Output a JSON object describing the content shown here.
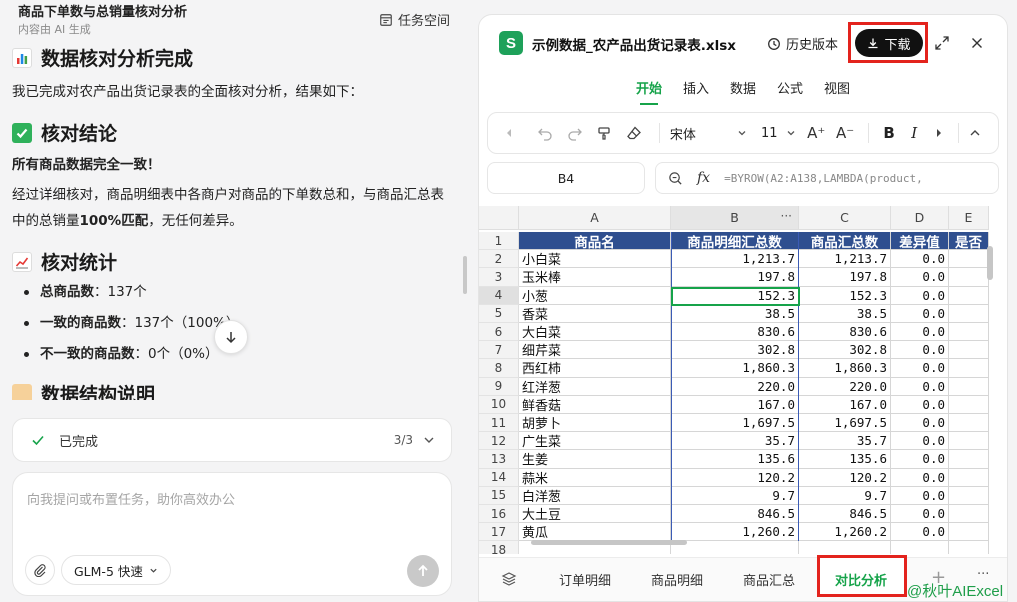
{
  "chat": {
    "title": "商品下单数与总销量核对分析",
    "subtitle": "内容由 AI 生成",
    "task_space": "任务空间",
    "heading1": "数据核对分析完成",
    "intro": "我已完成对农产品出货记录表的全面核对分析，结果如下：",
    "heading2": "核对结论",
    "conclusion_bold": "所有商品数据完全一致！",
    "para_a": "经过详细核对，商品明细表中各商户对商品的下单数总和，与商品汇总表中的总销量",
    "para_bold": "100%匹配",
    "para_b": "，无任何差异。",
    "heading3": "核对统计",
    "stats": [
      {
        "label": "总商品数",
        "value": "：137个"
      },
      {
        "label": "一致的商品数",
        "value": "：137个（100%）"
      },
      {
        "label": "不一致的商品数",
        "value": "：0个（0%）"
      }
    ],
    "heading4_partial": "数据结构说明",
    "status_label": "已完成",
    "status_count": "3/3",
    "input_placeholder": "向我提问或布置任务，助你高效办公",
    "model_label": "GLM-5 快速"
  },
  "sheet": {
    "file_icon": "S",
    "file_name": "示例数据_农产品出货记录表.xlsx",
    "history": "历史版本",
    "download": "下载",
    "menu": [
      "开始",
      "插入",
      "数据",
      "公式",
      "视图"
    ],
    "active_menu": 0,
    "font_name": "宋体",
    "font_size": "11",
    "cell_ref": "B4",
    "formula": "=BYROW(A2:A138,LAMBDA(product,",
    "columns": [
      "A",
      "B",
      "C",
      "D",
      "E"
    ],
    "header_row": [
      "商品名",
      "商品明细汇总数",
      "商品汇总数",
      "差异值",
      "是否"
    ],
    "rows": [
      [
        "小白菜",
        "1,213.7",
        "1,213.7",
        "0.0"
      ],
      [
        "玉米棒",
        "197.8",
        "197.8",
        "0.0"
      ],
      [
        "小葱",
        "152.3",
        "152.3",
        "0.0"
      ],
      [
        "香菜",
        "38.5",
        "38.5",
        "0.0"
      ],
      [
        "大白菜",
        "830.6",
        "830.6",
        "0.0"
      ],
      [
        "细芹菜",
        "302.8",
        "302.8",
        "0.0"
      ],
      [
        "西红柿",
        "1,860.3",
        "1,860.3",
        "0.0"
      ],
      [
        "红洋葱",
        "220.0",
        "220.0",
        "0.0"
      ],
      [
        "鲜香菇",
        "167.0",
        "167.0",
        "0.0"
      ],
      [
        "胡萝卜",
        "1,697.5",
        "1,697.5",
        "0.0"
      ],
      [
        "广生菜",
        "35.7",
        "35.7",
        "0.0"
      ],
      [
        "生姜",
        "135.6",
        "135.6",
        "0.0"
      ],
      [
        "蒜米",
        "120.2",
        "120.2",
        "0.0"
      ],
      [
        "白洋葱",
        "9.7",
        "9.7",
        "0.0"
      ],
      [
        "大土豆",
        "846.5",
        "846.5",
        "0.0"
      ],
      [
        "黄瓜",
        "1,260.2",
        "1,260.2",
        "0.0"
      ]
    ],
    "row_numbers": [
      "1",
      "2",
      "3",
      "4",
      "5",
      "6",
      "7",
      "8",
      "9",
      "10",
      "11",
      "12",
      "13",
      "14",
      "15",
      "16",
      "17",
      "18"
    ],
    "tabs": [
      "订单明细",
      "商品明细",
      "商品汇总",
      "对比分析"
    ],
    "active_tab": 3,
    "add_tab": "+",
    "more": "···"
  },
  "watermark": "@秋叶AIExcel",
  "colors": {
    "accent_green": "#16a34a",
    "header_blue": "#2f4f8f",
    "highlight_red": "#e3231d"
  }
}
